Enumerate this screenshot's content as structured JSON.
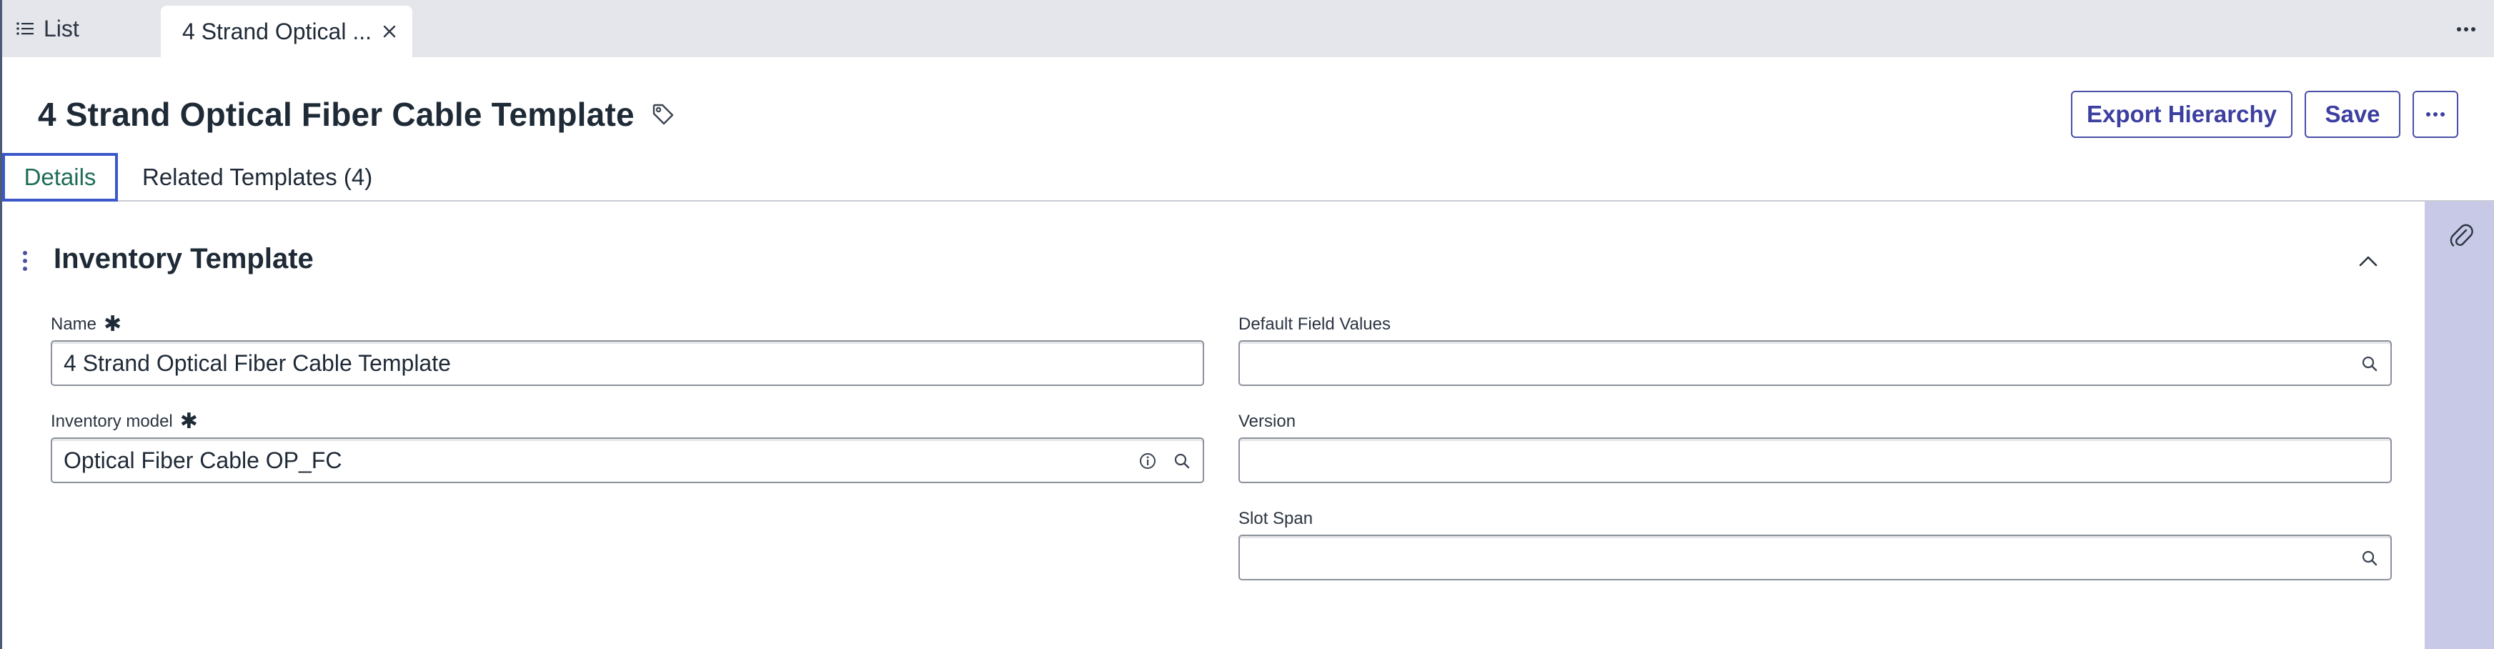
{
  "tabs": {
    "list_label": "List",
    "record_label": "4 Strand Optical ..."
  },
  "header": {
    "title": "4 Strand Optical Fiber Cable Template",
    "export_label": "Export Hierarchy",
    "save_label": "Save"
  },
  "form_tabs": [
    {
      "label": "Details"
    },
    {
      "label": "Related Templates (4)"
    }
  ],
  "section": {
    "title": "Inventory Template"
  },
  "fields": {
    "name": {
      "label": "Name",
      "value": "4 Strand Optical Fiber Cable Template",
      "required": true
    },
    "inventory_model": {
      "label": "Inventory model",
      "value": "Optical Fiber Cable OP_FC",
      "required": true
    },
    "default_field_values": {
      "label": "Default Field Values",
      "value": ""
    },
    "version": {
      "label": "Version",
      "value": ""
    },
    "slot_span": {
      "label": "Slot Span",
      "value": ""
    }
  },
  "colors": {
    "accent": "#3c3fa0",
    "active_tab_text": "#1e6b57",
    "active_tab_border": "#3b57c8",
    "sidebar": "#c8c9e6",
    "tabstrip": "#e5e6ec"
  },
  "icons": [
    "list-icon",
    "close-icon",
    "more-icon",
    "tag-icon",
    "ellipsis-icon",
    "drag-handle-icon",
    "chevron-up-icon",
    "paperclip-icon",
    "info-icon",
    "search-icon"
  ]
}
